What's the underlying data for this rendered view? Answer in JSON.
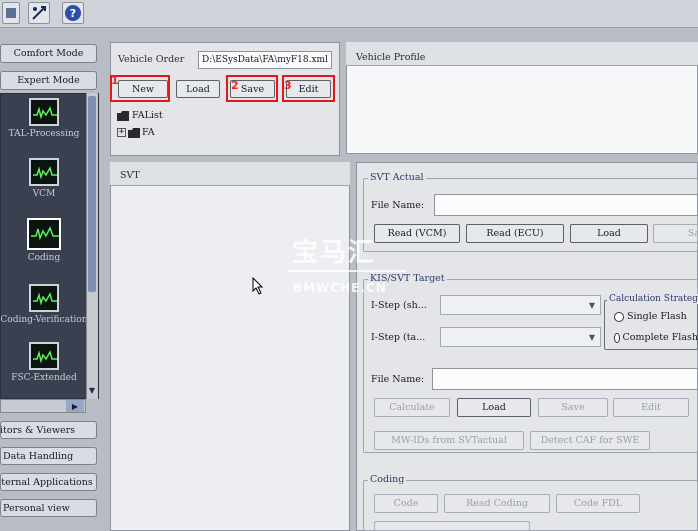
{
  "toolbar": {
    "icons": [
      "app-icon",
      "connection-icon",
      "help-icon"
    ],
    "help_glyph": "?"
  },
  "modes": {
    "comfort": "Comfort Mode",
    "expert": "Expert Mode"
  },
  "nav": {
    "items": [
      {
        "label": "TAL-Processing",
        "icon": "oscilloscope-icon"
      },
      {
        "label": "VCM",
        "icon": "oscilloscope-icon"
      },
      {
        "label": "Coding",
        "icon": "oscilloscope-icon"
      },
      {
        "label": "Coding-Verification",
        "icon": "oscilloscope-icon"
      },
      {
        "label": "FSC-Extended",
        "icon": "oscilloscope-icon"
      }
    ],
    "scroll_up": "▲",
    "scroll_down": "▼",
    "scroll_right": "▶"
  },
  "bottom_nav": [
    "Editors & Viewers",
    "Data Handling",
    "External Applications",
    "Personal view"
  ],
  "vehicle_order": {
    "title": "Vehicle Order",
    "path": "D:\\ESysData\\FA\\myF18.xml",
    "buttons": {
      "new": "New",
      "load": "Load",
      "save": "Save",
      "edit": "Edit"
    },
    "badges": {
      "new": "1",
      "save": "2",
      "edit": "3"
    },
    "tree": {
      "root": "FAList",
      "child": "FA",
      "expand": "+"
    }
  },
  "vehicle_profile": {
    "title": "Vehicle Profile"
  },
  "svt": {
    "title": "SVT"
  },
  "svt_actual": {
    "title": "SVT Actual",
    "file_name_label": "File Name:",
    "buttons": {
      "read_vcm": "Read (VCM)",
      "read_ecu": "Read (ECU)",
      "load": "Load",
      "save": "Save"
    }
  },
  "svt_target": {
    "title": "KIS/SVT Target",
    "istep_shipment_label": "I-Step (sh...",
    "istep_target_label": "I-Step (ta...",
    "calc_strategy": {
      "title": "Calculation Strategy",
      "single": "Single Flash",
      "complete": "Complete Flash"
    },
    "file_name_label": "File Name:",
    "buttons": {
      "calculate": "Calculate",
      "load": "Load",
      "save": "Save",
      "edit": "Edit"
    },
    "buttons2": {
      "mw_ids": "MW-IDs from SVTactual",
      "detect_caf": "Detect CAF for SWE"
    }
  },
  "coding": {
    "title": "Coding",
    "buttons": {
      "code": "Code",
      "read_coding": "Read Coding",
      "code_fdl": "Code FDL"
    }
  },
  "watermark": {
    "main": "宝马汇",
    "sub": "BMWCHE.CN"
  },
  "colors": {
    "highlight": "#e01818",
    "badge": "#ff2020",
    "nav_bg": "#3a4050"
  }
}
